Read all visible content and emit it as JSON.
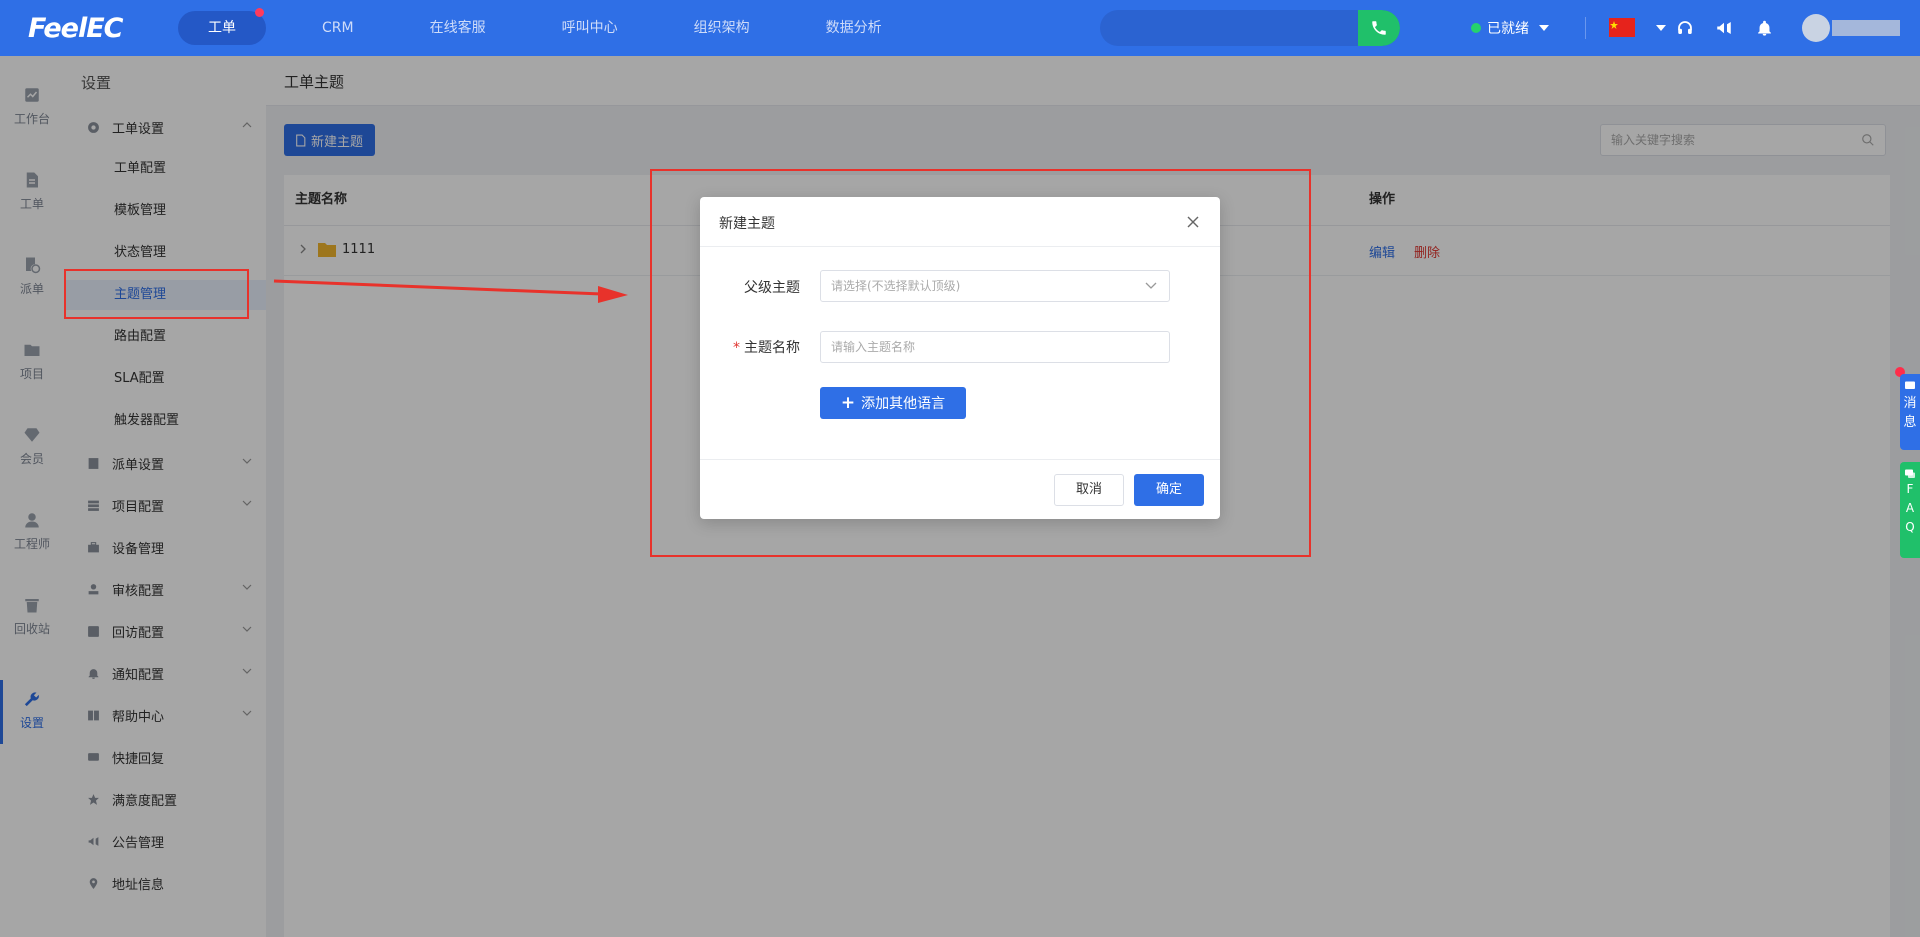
{
  "brand": {
    "logo_text": "FeelEC"
  },
  "topnav": {
    "items": [
      {
        "label": "工单",
        "active": true,
        "badge": true
      },
      {
        "label": "CRM"
      },
      {
        "label": "在线客服"
      },
      {
        "label": "呼叫中心"
      },
      {
        "label": "组织架构"
      },
      {
        "label": "数据分析"
      }
    ],
    "status_label": "已就绪"
  },
  "rail": {
    "items": [
      {
        "label": "工作台",
        "icon": "chart-icon"
      },
      {
        "label": "工单",
        "icon": "document-icon"
      },
      {
        "label": "派单",
        "icon": "dispatch-icon"
      },
      {
        "label": "项目",
        "icon": "folder-icon"
      },
      {
        "label": "会员",
        "icon": "diamond-icon"
      },
      {
        "label": "工程师",
        "icon": "engineer-icon"
      },
      {
        "label": "回收站",
        "icon": "trash-icon"
      },
      {
        "label": "设置",
        "icon": "wrench-icon",
        "active": true
      }
    ]
  },
  "menu": {
    "title": "设置",
    "group_ticket": "工单设置",
    "subs": [
      "工单配置",
      "模板管理",
      "状态管理",
      "主题管理",
      "路由配置",
      "SLA配置",
      "触发器配置"
    ],
    "groups": [
      "派单设置",
      "项目配置",
      "设备管理",
      "审核配置",
      "回访配置",
      "通知配置",
      "帮助中心",
      "快捷回复",
      "满意度配置",
      "公告管理",
      "地址信息"
    ]
  },
  "main": {
    "breadcrumb": "工单主题",
    "new_button": "新建主题",
    "search_placeholder": "输入关键字搜索",
    "table": {
      "col_name": "主题名称",
      "col_ops": "操作",
      "rows": [
        {
          "name": "1111",
          "edit": "编辑",
          "delete": "删除"
        }
      ]
    }
  },
  "dialog": {
    "title": "新建主题",
    "parent_label": "父级主题",
    "parent_placeholder": "请选择(不选择默认顶级)",
    "name_label": "主题名称",
    "name_placeholder": "请输入主题名称",
    "add_lang": "添加其他语言",
    "cancel": "取消",
    "confirm": "确定"
  },
  "side": {
    "msg": [
      "消",
      "息"
    ],
    "faq": [
      "F",
      "A",
      "Q"
    ]
  },
  "colors": {
    "primary": "#2f6fe6",
    "annotation": "#e8322b",
    "success": "#20c06a"
  }
}
